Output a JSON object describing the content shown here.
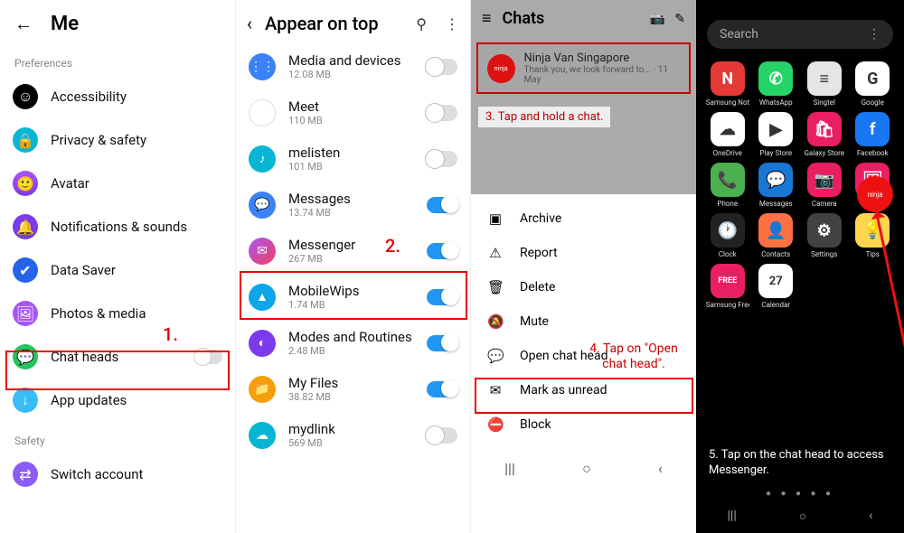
{
  "panel1": {
    "title": "Me",
    "section1": "Preferences",
    "items": [
      {
        "label": "Accessibility"
      },
      {
        "label": "Privacy & safety"
      },
      {
        "label": "Avatar"
      },
      {
        "label": "Notifications & sounds"
      },
      {
        "label": "Data Saver"
      },
      {
        "label": "Photos & media"
      },
      {
        "label": "Chat heads"
      },
      {
        "label": "App updates"
      }
    ],
    "section2": "Safety",
    "items2": [
      {
        "label": "Switch account"
      }
    ],
    "anno": "1."
  },
  "panel2": {
    "title": "Appear on top",
    "apps": [
      {
        "name": "Media and devices",
        "size": "12.08 MB",
        "on": false
      },
      {
        "name": "Meet",
        "size": "110 MB",
        "on": false
      },
      {
        "name": "melisten",
        "size": "101 MB",
        "on": false
      },
      {
        "name": "Messages",
        "size": "13.74 MB",
        "on": true
      },
      {
        "name": "Messenger",
        "size": "267 MB",
        "on": true
      },
      {
        "name": "MobileWips",
        "size": "1.74 MB",
        "on": true
      },
      {
        "name": "Modes and Routines",
        "size": "2.48 MB",
        "on": true
      },
      {
        "name": "My Files",
        "size": "38.82 MB",
        "on": true
      },
      {
        "name": "mydlink",
        "size": "569 MB",
        "on": false
      }
    ],
    "anno": "2."
  },
  "panel3": {
    "title": "Chats",
    "chat": {
      "name": "Ninja Van Singapore",
      "sub": "Thank you, we look forward to...  · 11 May",
      "avatar": "ninja"
    },
    "instr1": "3. Tap and hold a chat.",
    "menu": [
      "Archive",
      "Report",
      "Delete",
      "Mute",
      "Open chat head",
      "Mark as unread",
      "Block"
    ],
    "instr2a": "4. Tap on \"Open",
    "instr2b": "chat head\"."
  },
  "panel4": {
    "search": "Search",
    "apps": [
      {
        "l": "Samsung Notes",
        "c": "a-red"
      },
      {
        "l": "WhatsApp",
        "c": "a-green"
      },
      {
        "l": "Singtel",
        "c": "a-gray"
      },
      {
        "l": "Google",
        "c": "a-white"
      },
      {
        "l": "OneDrive",
        "c": "a-white"
      },
      {
        "l": "Play Store",
        "c": "a-white"
      },
      {
        "l": "Galaxy Store",
        "c": "a-pink"
      },
      {
        "l": "Facebook",
        "c": "a-blue"
      },
      {
        "l": "Phone",
        "c": "a-lgreen"
      },
      {
        "l": "Messages",
        "c": "a-dblue"
      },
      {
        "l": "Camera",
        "c": "a-pink"
      },
      {
        "l": "Gallery",
        "c": "a-pink"
      },
      {
        "l": "Clock",
        "c": "a-black"
      },
      {
        "l": "Contacts",
        "c": "a-orange"
      },
      {
        "l": "Settings",
        "c": "a-dgray"
      },
      {
        "l": "Tips",
        "c": "a-yellow"
      },
      {
        "l": "Samsung Free",
        "c": "a-pink"
      },
      {
        "l": "Calendar",
        "c": "a-white"
      }
    ],
    "ninja": "ninja",
    "text": "5. Tap on the chat head to access Messenger."
  }
}
